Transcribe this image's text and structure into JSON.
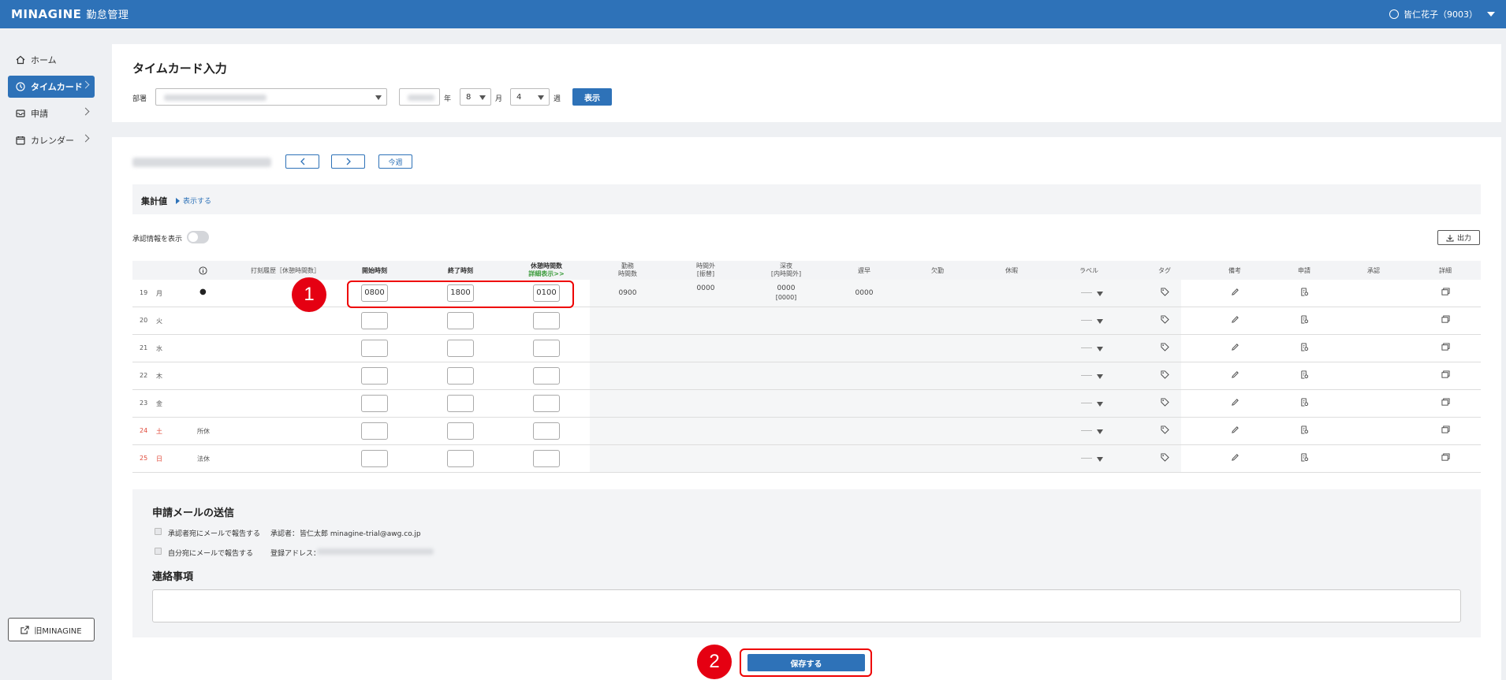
{
  "header": {
    "logo": "MINAGINE",
    "logo_sub": "勤怠管理",
    "user": "皆仁花子（9003）"
  },
  "sidebar": {
    "items": [
      {
        "label": "ホーム",
        "icon": "home-icon"
      },
      {
        "label": "タイムカード",
        "icon": "clock-icon",
        "active": true
      },
      {
        "label": "申請",
        "icon": "inbox-icon"
      },
      {
        "label": "カレンダー",
        "icon": "calendar-icon"
      }
    ],
    "old_link": "旧MINAGINE"
  },
  "filters": {
    "title": "タイムカード入力",
    "dept_label": "部署",
    "year_suffix": "年",
    "month_value": "8",
    "month_suffix": "月",
    "week_value": "4",
    "week_suffix": "週",
    "show_button": "表示"
  },
  "nav": {
    "prev": "<",
    "next": ">",
    "this_week": "今週"
  },
  "summary": {
    "label": "集計値",
    "toggle_link": "表示する"
  },
  "approval_toggle_label": "承認情報を表示",
  "export_button": "出力",
  "table": {
    "headers": {
      "stamp": "打刻履歴［休憩時間数］",
      "start": "開始時刻",
      "end": "終了時刻",
      "break": "休憩時間数",
      "break_detail": "詳細表示>>",
      "work": "勤務",
      "work2": "時間数",
      "ot": "時間外",
      "ot2": "[振替]",
      "night": "深夜",
      "night2": "[内時間外]",
      "late": "遅早",
      "absent": "欠勤",
      "leave": "休暇",
      "label": "ラベル",
      "tag": "タグ",
      "note": "備考",
      "apply": "申請",
      "approve": "承認",
      "detail": "詳細"
    },
    "rows": [
      {
        "date": "19",
        "dow": "月",
        "mark": "●",
        "type": "",
        "start": "0800",
        "end": "1800",
        "break": "0100",
        "work": "0900",
        "ot": "0000",
        "night": "0000",
        "night2": "[0000]",
        "late": "0000",
        "weekend": false
      },
      {
        "date": "20",
        "dow": "火",
        "mark": "",
        "type": "",
        "start": "",
        "end": "",
        "break": "",
        "work": "",
        "ot": "",
        "night": "",
        "night2": "",
        "late": "",
        "weekend": false
      },
      {
        "date": "21",
        "dow": "水",
        "mark": "",
        "type": "",
        "start": "",
        "end": "",
        "break": "",
        "work": "",
        "ot": "",
        "night": "",
        "night2": "",
        "late": "",
        "weekend": false
      },
      {
        "date": "22",
        "dow": "木",
        "mark": "",
        "type": "",
        "start": "",
        "end": "",
        "break": "",
        "work": "",
        "ot": "",
        "night": "",
        "night2": "",
        "late": "",
        "weekend": false
      },
      {
        "date": "23",
        "dow": "金",
        "mark": "",
        "type": "",
        "start": "",
        "end": "",
        "break": "",
        "work": "",
        "ot": "",
        "night": "",
        "night2": "",
        "late": "",
        "weekend": false
      },
      {
        "date": "24",
        "dow": "土",
        "mark": "",
        "type": "所休",
        "start": "",
        "end": "",
        "break": "",
        "work": "",
        "ot": "",
        "night": "",
        "night2": "",
        "late": "",
        "weekend": true
      },
      {
        "date": "25",
        "dow": "日",
        "mark": "",
        "type": "法休",
        "start": "",
        "end": "",
        "break": "",
        "work": "",
        "ot": "",
        "night": "",
        "night2": "",
        "late": "",
        "weekend": true
      }
    ]
  },
  "mail": {
    "title": "申請メールの送信",
    "opt1": "承認者宛にメールで報告する",
    "approver_label": "承認者：",
    "approver_value": "皆仁太郎 minagine-trial@awg.co.jp",
    "opt2": "自分宛にメールで報告する",
    "address_label": "登録アドレス：",
    "notes_title": "連絡事項"
  },
  "save_button": "保存する",
  "annotations": [
    "1",
    "2"
  ],
  "colors": {
    "primary": "#2e72b8",
    "annotation": "#e50012",
    "weekend": "#e04a3a",
    "link_green": "#3a9b3a"
  }
}
